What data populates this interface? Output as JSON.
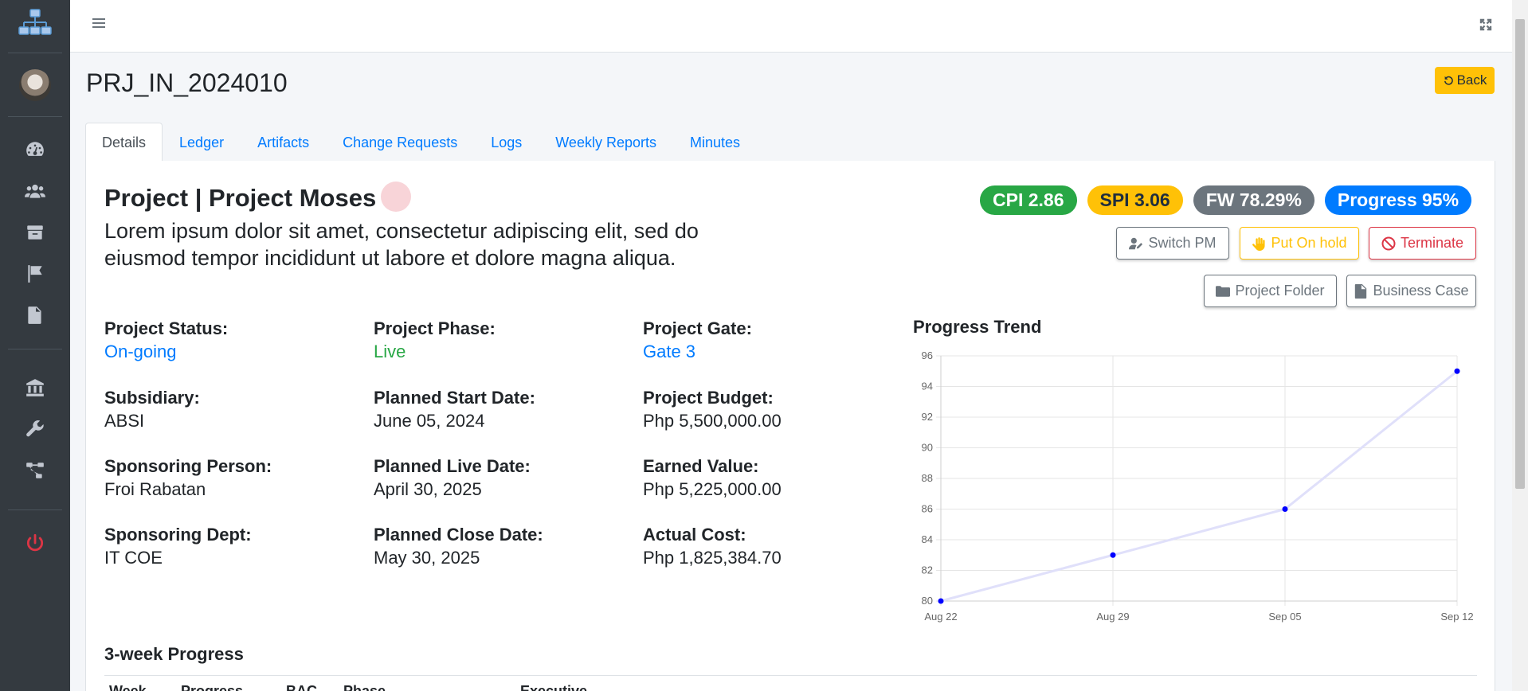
{
  "icons": {
    "logo": "sitemap-icon",
    "dashboard": "tachometer-icon",
    "users": "users-icon",
    "box": "box-icon",
    "flag": "flag-icon",
    "file": "file-icon",
    "bank": "bank-icon",
    "wrench": "wrench-icon",
    "network": "network-icon",
    "power": "power-icon"
  },
  "page": {
    "title": "PRJ_IN_2024010",
    "back_label": "Back"
  },
  "tabs": [
    {
      "label": "Details",
      "active": true
    },
    {
      "label": "Ledger"
    },
    {
      "label": "Artifacts"
    },
    {
      "label": "Change Requests"
    },
    {
      "label": "Logs"
    },
    {
      "label": "Weekly Reports"
    },
    {
      "label": "Minutes"
    }
  ],
  "project": {
    "title": "Project | Project Moses",
    "description": "Lorem ipsum dolor sit amet, consectetur adipiscing elit, sed do eiusmod tempor incididunt ut labore et dolore magna aliqua."
  },
  "badges": {
    "cpi": "CPI 2.86",
    "spi": "SPI 3.06",
    "fw": "FW 78.29%",
    "progress": "Progress 95%"
  },
  "actions": {
    "switch_pm": "Switch PM",
    "put_on_hold": "Put On hold",
    "terminate": "Terminate",
    "project_folder": "Project Folder",
    "business_case": "Business Case"
  },
  "fields": {
    "status": {
      "label": "Project Status:",
      "value": "On-going"
    },
    "phase": {
      "label": "Project Phase:",
      "value": "Live"
    },
    "gate": {
      "label": "Project Gate:",
      "value": "Gate 3"
    },
    "subsidiary": {
      "label": "Subsidiary:",
      "value": "ABSI"
    },
    "planned_start": {
      "label": "Planned Start Date:",
      "value": "June 05, 2024"
    },
    "budget": {
      "label": "Project Budget:",
      "value": "Php 5,500,000.00"
    },
    "sponsoring_person": {
      "label": "Sponsoring Person:",
      "value": "Froi Rabatan"
    },
    "planned_live": {
      "label": "Planned Live Date:",
      "value": "April 30, 2025"
    },
    "earned_value": {
      "label": "Earned Value:",
      "value": "Php 5,225,000.00"
    },
    "sponsoring_dept": {
      "label": "Sponsoring Dept:",
      "value": "IT COE"
    },
    "planned_close": {
      "label": "Planned Close Date:",
      "value": "May 30, 2025"
    },
    "actual_cost": {
      "label": "Actual Cost:",
      "value": "Php 1,825,384.70"
    }
  },
  "chart_title": "Progress Trend",
  "chart_data": {
    "type": "line",
    "title": "Progress Trend",
    "x": [
      "Aug 22",
      "Aug 29",
      "Sep 05",
      "Sep 12"
    ],
    "series": [
      {
        "values": [
          80,
          83,
          86,
          95
        ]
      }
    ],
    "ylim": [
      80,
      96
    ],
    "yticks": [
      80,
      82,
      84,
      86,
      88,
      90,
      92,
      94,
      96
    ],
    "grid": true,
    "line_color": "#e0e0fa",
    "point_color": "#0000ff"
  },
  "three_week": {
    "title": "3-week Progress",
    "headers": [
      "Week",
      "Progress",
      "BAC",
      "Phase",
      "Executive"
    ]
  }
}
